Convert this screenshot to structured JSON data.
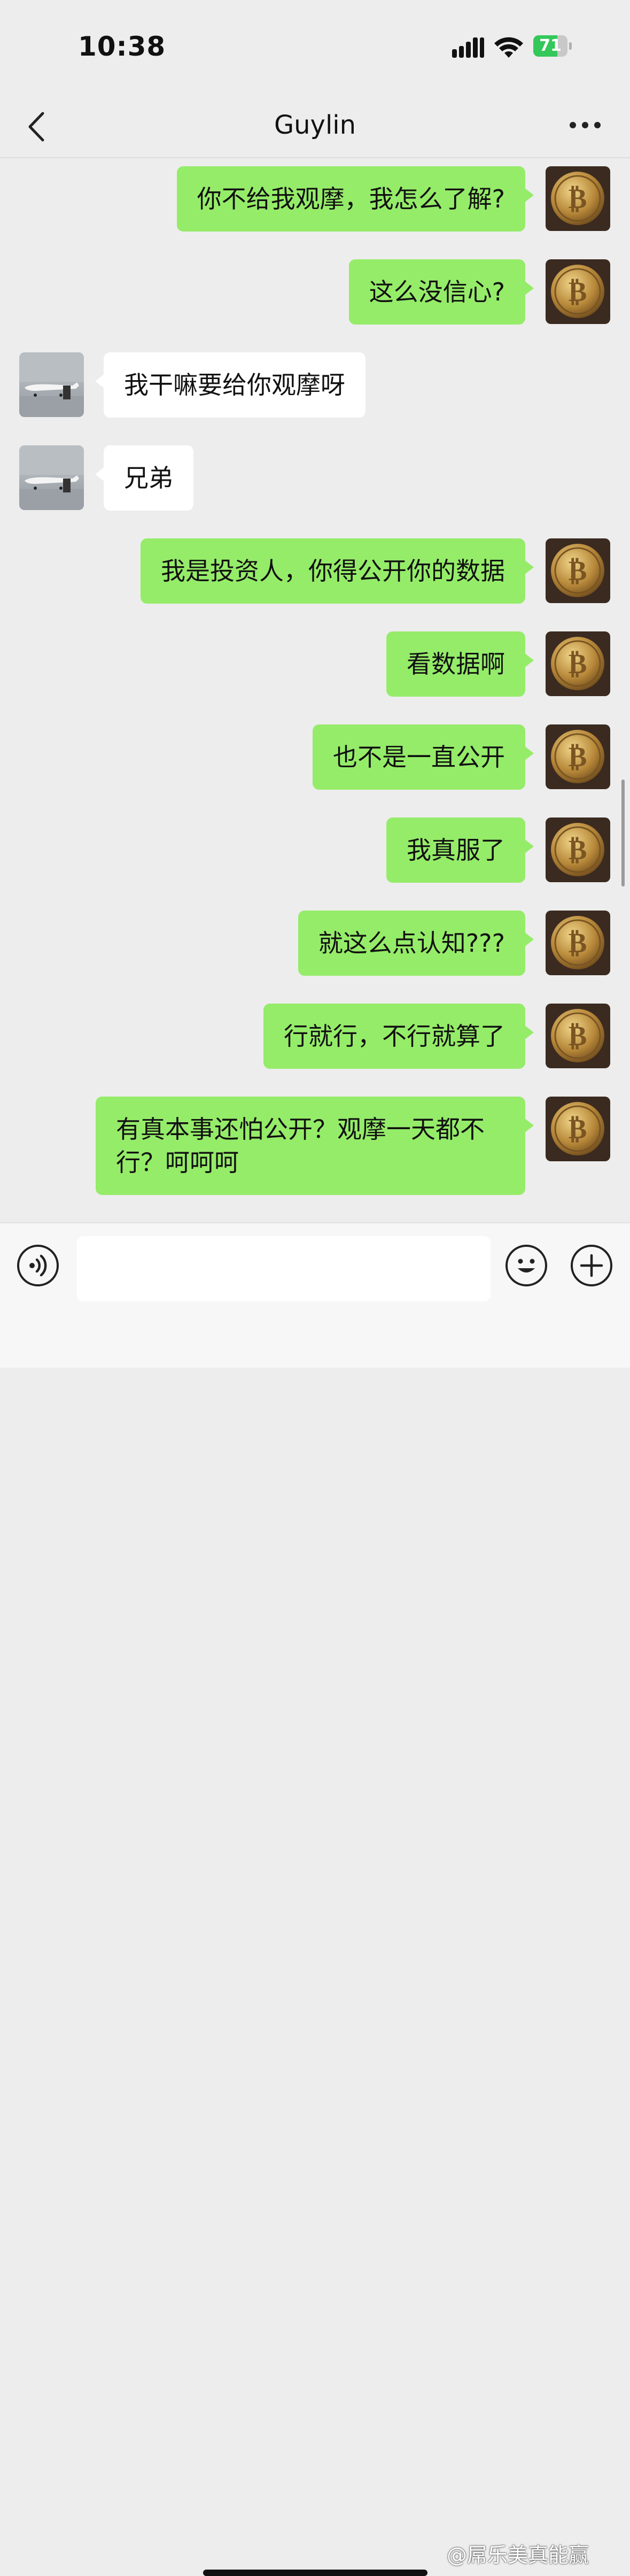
{
  "status_bar": {
    "time": "10:38",
    "battery": "71",
    "battery_level": 0.71
  },
  "header": {
    "title": "Guylin"
  },
  "messages": [
    {
      "side": "out",
      "text": "你不给我观摩，我怎么了解?"
    },
    {
      "side": "out",
      "text": "这么没信心?"
    },
    {
      "side": "in",
      "text": "我干嘛要给你观摩呀"
    },
    {
      "side": "in",
      "text": "兄弟"
    },
    {
      "side": "out",
      "text": "我是投资人，你得公开你的数据"
    },
    {
      "side": "out",
      "text": "看数据啊"
    },
    {
      "side": "out",
      "text": "也不是一直公开"
    },
    {
      "side": "out",
      "text": "我真服了"
    },
    {
      "side": "out",
      "text": "就这么点认知???"
    },
    {
      "side": "out",
      "text": "行就行，不行就算了"
    },
    {
      "side": "out",
      "text": "有真本事还怕公开？观摩一天都不行？呵呵呵"
    }
  ],
  "input": {
    "placeholder": ""
  },
  "watermark": "@屌乐美真能赢",
  "colors": {
    "outgoing": "#95ec69",
    "incoming": "#ffffff",
    "background": "#ededed",
    "battery": "#34c759"
  },
  "icons": {
    "back": "chevron-left-icon",
    "more": "more-dots-icon",
    "voice": "voice-icon",
    "emoji": "emoji-icon",
    "plus": "plus-icon",
    "signal": "signal-icon",
    "wifi": "wifi-icon",
    "battery": "battery-icon"
  }
}
